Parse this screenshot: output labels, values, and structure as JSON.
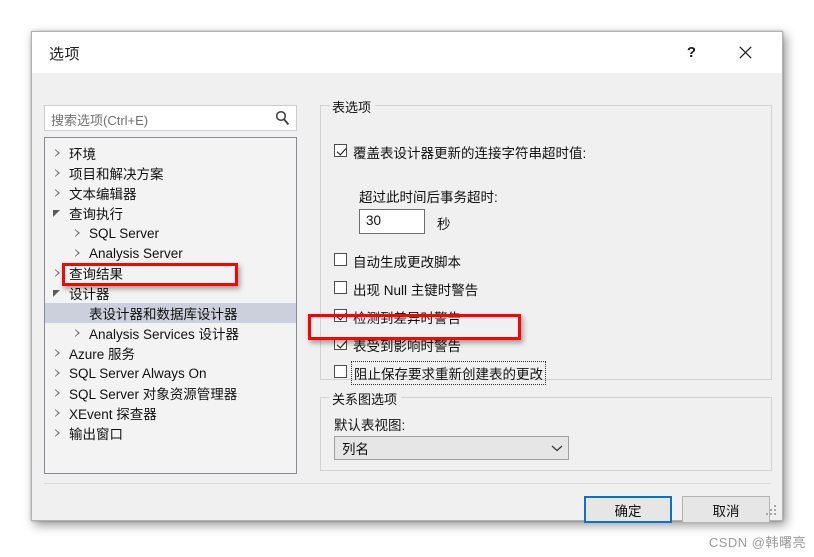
{
  "window": {
    "title": "选项",
    "help_button": "?",
    "help_icon": "question-mark-icon",
    "close_icon": "close-icon"
  },
  "search": {
    "placeholder": "搜索选项(Ctrl+E)",
    "value": "",
    "icon": "search-icon"
  },
  "tree": {
    "items": [
      {
        "label": "环境",
        "level": 0,
        "state": "collapsed",
        "selected": false
      },
      {
        "label": "项目和解决方案",
        "level": 0,
        "state": "collapsed",
        "selected": false
      },
      {
        "label": "文本编辑器",
        "level": 0,
        "state": "collapsed",
        "selected": false
      },
      {
        "label": "查询执行",
        "level": 0,
        "state": "expanded",
        "selected": false
      },
      {
        "label": "SQL Server",
        "level": 1,
        "state": "collapsed",
        "selected": false
      },
      {
        "label": "Analysis Server",
        "level": 1,
        "state": "collapsed",
        "selected": false
      },
      {
        "label": "查询结果",
        "level": 0,
        "state": "collapsed",
        "selected": false
      },
      {
        "label": "设计器",
        "level": 0,
        "state": "expanded",
        "selected": false
      },
      {
        "label": "表设计器和数据库设计器",
        "level": 1,
        "state": "none",
        "selected": true
      },
      {
        "label": "Analysis Services 设计器",
        "level": 1,
        "state": "collapsed",
        "selected": false
      },
      {
        "label": "Azure 服务",
        "level": 0,
        "state": "collapsed",
        "selected": false
      },
      {
        "label": "SQL Server Always On",
        "level": 0,
        "state": "collapsed",
        "selected": false
      },
      {
        "label": "SQL Server 对象资源管理器",
        "level": 0,
        "state": "collapsed",
        "selected": false
      },
      {
        "label": "XEvent 探查器",
        "level": 0,
        "state": "collapsed",
        "selected": false
      },
      {
        "label": "输出窗口",
        "level": 0,
        "state": "collapsed",
        "selected": false
      }
    ]
  },
  "table_options": {
    "group_title": "表选项",
    "override_timeout": {
      "label": "覆盖表设计器更新的连接字符串超时值:",
      "checked": true
    },
    "timeout_sub_label": "超过此时间后事务超时:",
    "timeout_value": "30",
    "timeout_unit": "秒",
    "auto_generate_script": {
      "label": "自动生成更改脚本",
      "checked": false
    },
    "warn_null_pk": {
      "label": "出现 Null 主键时警告",
      "checked": false
    },
    "warn_difference": {
      "label": "检测到差异时警告",
      "checked": true
    },
    "warn_affected": {
      "label": "表受到影响时警告",
      "checked": true
    },
    "prevent_save": {
      "label": "阻止保存要求重新创建表的更改",
      "checked": false,
      "focused": true
    }
  },
  "diagram_options": {
    "group_title": "关系图选项",
    "default_table_view_label": "默认表视图:",
    "default_table_view_value": "列名",
    "dropdown_icon": "chevron-down-icon"
  },
  "footer": {
    "ok_label": "确定",
    "cancel_label": "取消"
  },
  "watermark": "CSDN @韩曙亮",
  "colors": {
    "accent": "#0a73c8",
    "annotation": "#ff0000",
    "selection": "#ccd0dd",
    "dialog_bg": "#f0f0f0"
  }
}
